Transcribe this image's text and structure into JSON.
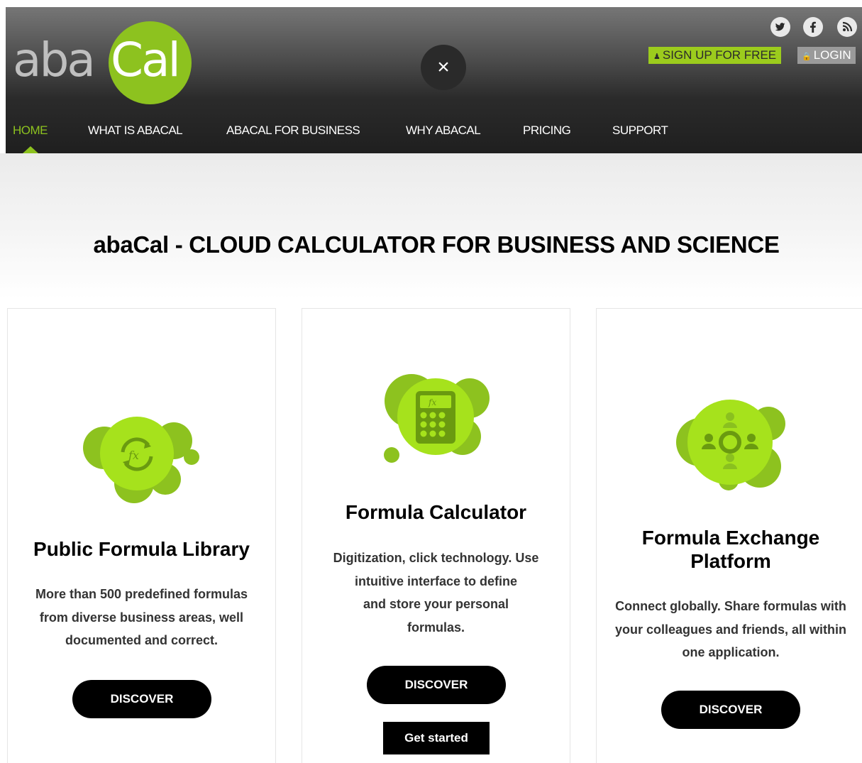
{
  "brand": {
    "logo_part1": "aba",
    "logo_part2": "Cal",
    "brand_color": "#8dc21f"
  },
  "header": {
    "close_label": "×",
    "social": [
      {
        "icon": "twitter-icon"
      },
      {
        "icon": "facebook-icon"
      },
      {
        "icon": "rss-icon"
      }
    ],
    "signup_label": "SIGN UP FOR FREE",
    "login_label": "LOGIN"
  },
  "nav": {
    "items": [
      {
        "label": "HOME",
        "active": true
      },
      {
        "label": "WHAT IS ABACAL"
      },
      {
        "label": "ABACAL FOR BUSINESS"
      },
      {
        "label": "WHY ABACAL"
      },
      {
        "label": "PRICING"
      },
      {
        "label": "SUPPORT"
      }
    ]
  },
  "hero": {
    "title": "abaCal - CLOUD CALCULATOR FOR BUSINESS AND SCIENCE"
  },
  "cards": [
    {
      "icon": "formula-library-icon",
      "title": "Public Formula Library",
      "desc": [
        "More than 500 predefined formulas",
        "from diverse business areas, well",
        "documented and correct."
      ],
      "button": "DISCOVER"
    },
    {
      "icon": "calculator-icon",
      "title": "Formula Calculator",
      "desc": [
        "Digitization, click technology. Use",
        "intuitive interface to define",
        "and store your personal",
        "formulas."
      ],
      "button": "DISCOVER",
      "secondary_button": "Get started"
    },
    {
      "icon": "exchange-network-icon",
      "title": "Formula Exchange Platform",
      "title_lines": [
        "Formula Exchange",
        "Platform"
      ],
      "desc": [
        "Connect globally. Share formulas with",
        "your colleagues and friends, all within",
        "one application."
      ],
      "button": "DISCOVER"
    }
  ]
}
